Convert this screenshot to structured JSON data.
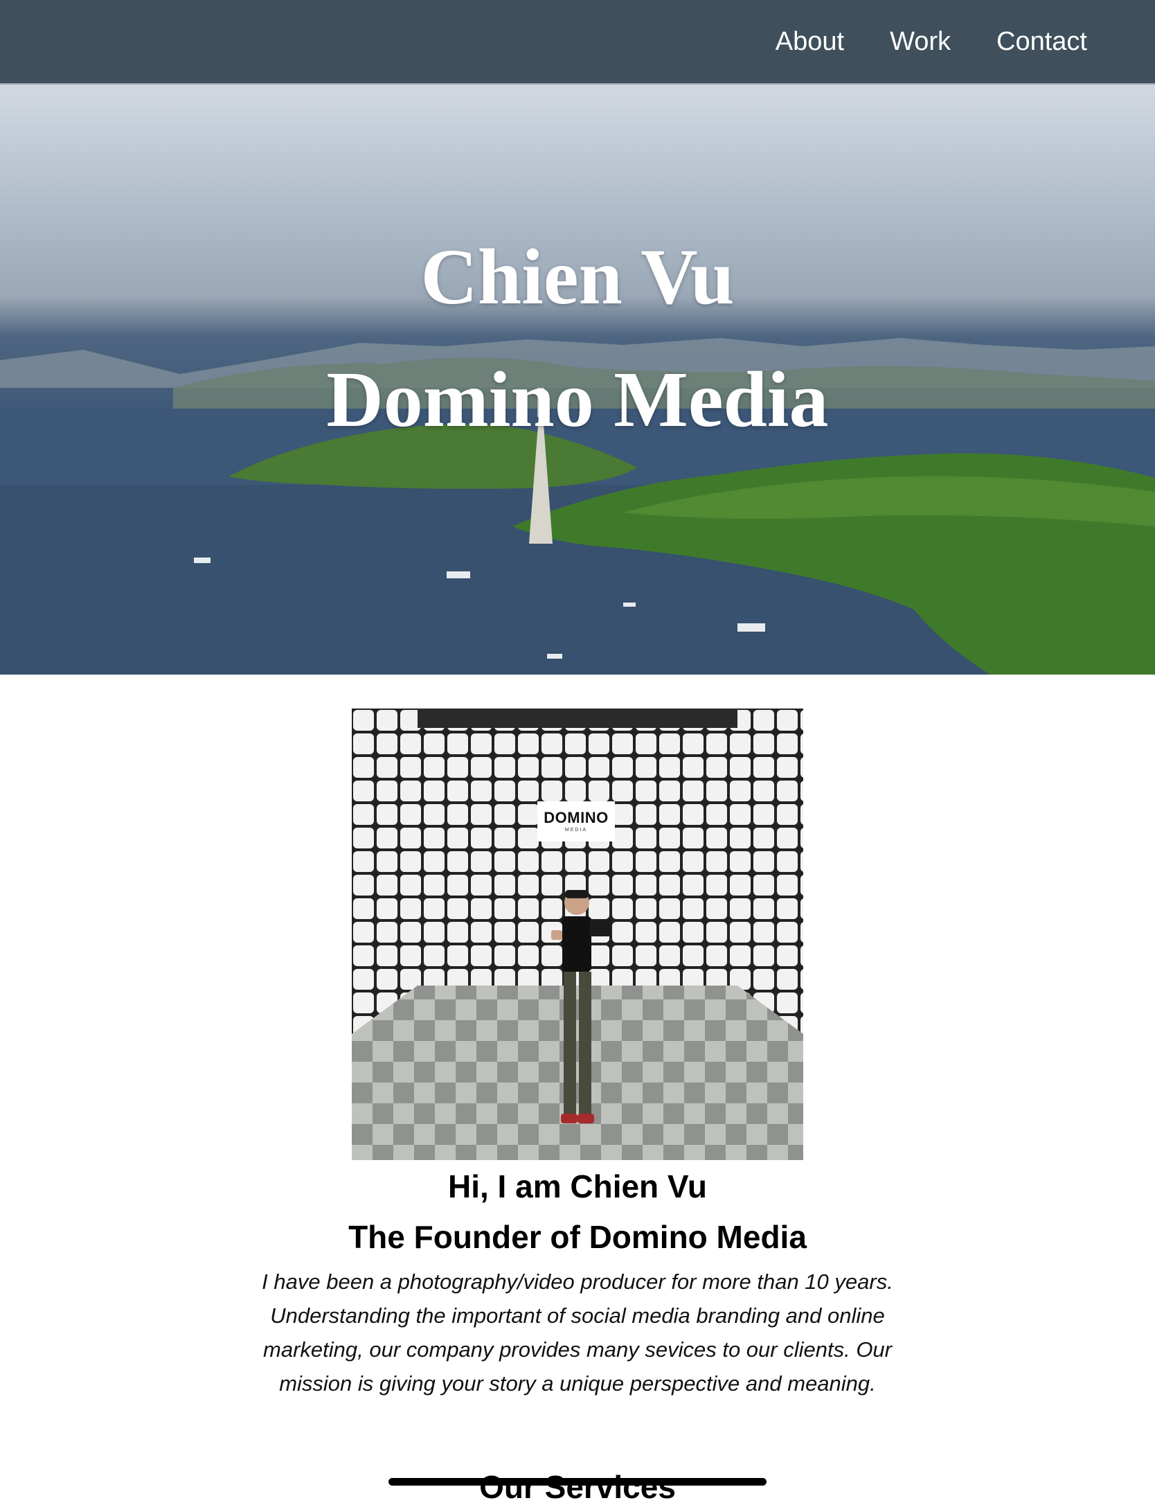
{
  "nav": {
    "items": [
      "About",
      "Work",
      "Contact"
    ]
  },
  "hero": {
    "title_line1": "Chien Vu",
    "title_line2": "Domino Media"
  },
  "photo": {
    "logo_text": "DOMINO",
    "logo_subtext": "MEDIA"
  },
  "about": {
    "greeting": "Hi, I am Chien Vu",
    "role": "The Founder of Domino Media",
    "bio": "I have been a photography/video producer for more than 10 years. Understanding the important of social media branding and online marketing, our company provides many sevices to our clients. Our mission is giving your story a unique perspective and meaning."
  },
  "services": {
    "heading": "Our Services"
  },
  "colors": {
    "navbar": "#3f505c",
    "text": "#000000",
    "hero_text": "#ffffff"
  }
}
